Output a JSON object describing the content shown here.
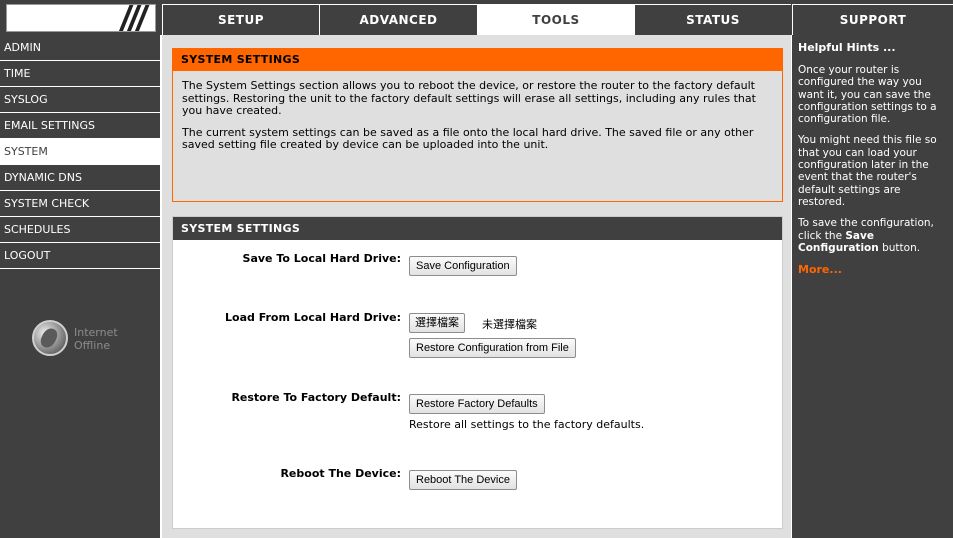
{
  "tabs": {
    "setup": "SETUP",
    "advanced": "ADVANCED",
    "tools": "TOOLS",
    "status": "STATUS",
    "support": "SUPPORT"
  },
  "sidebar": {
    "items": [
      "ADMIN",
      "TIME",
      "SYSLOG",
      "EMAIL SETTINGS",
      "SYSTEM",
      "DYNAMIC DNS",
      "SYSTEM CHECK",
      "SCHEDULES",
      "LOGOUT"
    ],
    "active_item": "SYSTEM",
    "internet_status": "Internet Offline",
    "globe_icon": "globe-icon"
  },
  "info": {
    "title": "SYSTEM SETTINGS",
    "para1": "The System Settings section allows you to reboot the device, or restore the router to the factory default settings. Restoring the unit to the factory default settings will erase all settings, including any rules that you have created.",
    "para2": "The current system settings can be saved as a file onto the local hard drive. The saved file or any other saved setting file created by device can be uploaded into the unit."
  },
  "settings": {
    "title": "SYSTEM SETTINGS",
    "save_label": "Save To Local Hard Drive:",
    "save_button": "Save Configuration",
    "load_label": "Load From Local Hard Drive:",
    "choose_file_button": "選擇檔案",
    "no_file_text": "未選擇檔案",
    "restore_file_button": "Restore Configuration from File",
    "factory_label": "Restore To Factory Default:",
    "factory_button": "Restore Factory Defaults",
    "factory_note": "Restore all settings to the factory defaults.",
    "reboot_label": "Reboot The Device:",
    "reboot_button": "Reboot The Device"
  },
  "hints": {
    "title": "Helpful Hints ...",
    "hint1": "Once your router is configured the way you want it, you can save the configuration settings to a configuration file.",
    "hint2": "You might need this file so that you can load your configuration later in the event that the router's default settings are restored.",
    "hint3_prefix": "To save the configuration, click the",
    "hint3_bold": "Save Configuration",
    "hint3_suffix": "button.",
    "more": "More..."
  },
  "colors": {
    "orange": "#ff6600",
    "dark": "#404040",
    "panel": "#dfdfdf"
  }
}
